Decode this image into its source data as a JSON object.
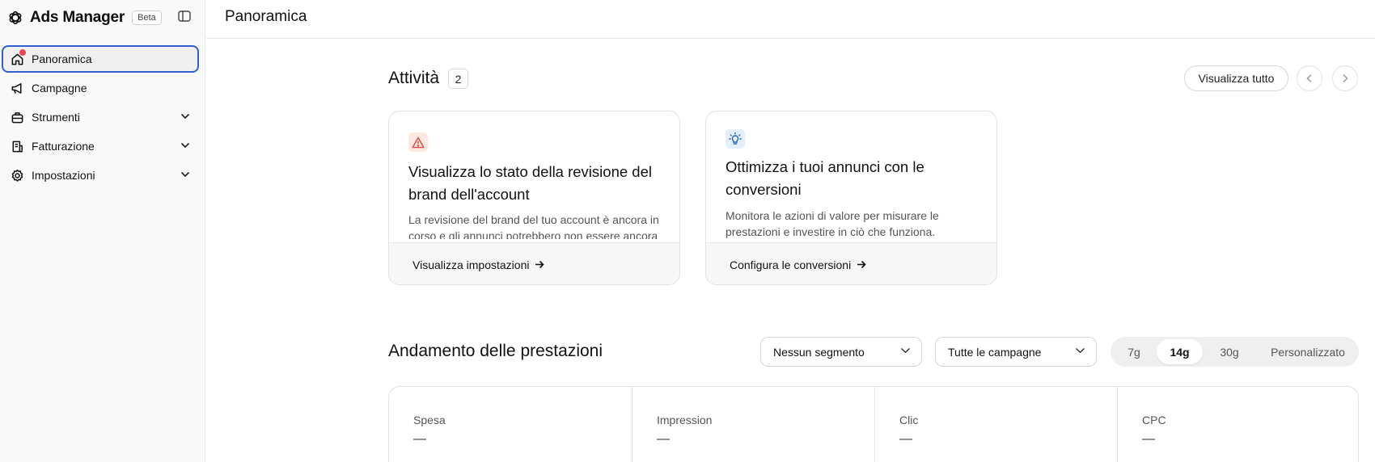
{
  "app": {
    "title": "Ads Manager",
    "badge": "Beta",
    "logo_icon": "openai-logo-icon"
  },
  "sidebar": {
    "items": [
      {
        "label": "Panoramica",
        "icon": "home-icon",
        "active": true,
        "notification": true
      },
      {
        "label": "Campagne",
        "icon": "megaphone-icon"
      },
      {
        "label": "Strumenti",
        "icon": "toolbox-icon",
        "expandable": true
      },
      {
        "label": "Fatturazione",
        "icon": "receipt-icon",
        "expandable": true
      },
      {
        "label": "Impostazioni",
        "icon": "gear-icon",
        "expandable": true
      }
    ]
  },
  "header": {
    "title": "Panoramica"
  },
  "activity": {
    "title": "Attività",
    "count": "2",
    "view_all": "Visualizza tutto",
    "cards": [
      {
        "icon": "warning-triangle-icon",
        "title": "Visualizza lo stato della revisione del brand dell'account",
        "description": "La revisione del brand del tuo account è ancora in corso e gli annunci potrebbero non essere ancora",
        "action": "Visualizza impostazioni"
      },
      {
        "icon": "lightbulb-icon",
        "title": "Ottimizza i tuoi annunci con le conversioni",
        "description": "Monitora le azioni di valore per misurare le prestazioni e investire in ciò che funziona.",
        "action": "Configura le conversioni"
      }
    ]
  },
  "performance": {
    "title": "Andamento delle prestazioni",
    "segment_select": "Nessun segmento",
    "campaign_select": "Tutte le campagne",
    "ranges": [
      "7g",
      "14g",
      "30g",
      "Personalizzato"
    ],
    "selected_range": "14g",
    "metrics": [
      {
        "label": "Spesa",
        "value": "—"
      },
      {
        "label": "Impression",
        "value": "—"
      },
      {
        "label": "Clic",
        "value": "—"
      },
      {
        "label": "CPC",
        "value": "—"
      }
    ]
  },
  "colors": {
    "active_border": "#2f5fd0",
    "notification_dot": "#e8474f",
    "warning_bg": "#fde7e1",
    "warning_fg": "#d9534f",
    "tip_bg": "#e3effb",
    "tip_fg": "#2b6cb0"
  }
}
